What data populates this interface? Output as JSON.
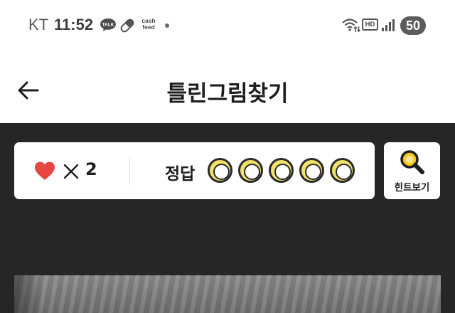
{
  "status_bar": {
    "carrier": "KT",
    "time": "11:52",
    "talk_badge": "TALK",
    "cashfeed_line1": "cash",
    "cashfeed_line2": "feed",
    "hd_label": "HD",
    "battery": "50",
    "icons": [
      "talk-icon",
      "pill-icon",
      "cashfeed-icon",
      "dot-icon",
      "wifi-icon",
      "hd-icon",
      "signal-icon",
      "battery-badge"
    ]
  },
  "header": {
    "back_icon": "back-arrow-icon",
    "title": "틀린그림찾기"
  },
  "score_panel": {
    "lives_icon": "heart-icon",
    "lives_prefix_icon": "times-icon",
    "lives": "2",
    "answer_label": "정답",
    "answer_slots_total": 5,
    "answer_slots_found": 0
  },
  "hint": {
    "icon": "magnifier-icon",
    "label": "힌트보기"
  },
  "colors": {
    "heart": "#e84545",
    "slot_fill": "#f2e26a",
    "hint_lens": "#f2c81e",
    "game_background": "#262626"
  }
}
